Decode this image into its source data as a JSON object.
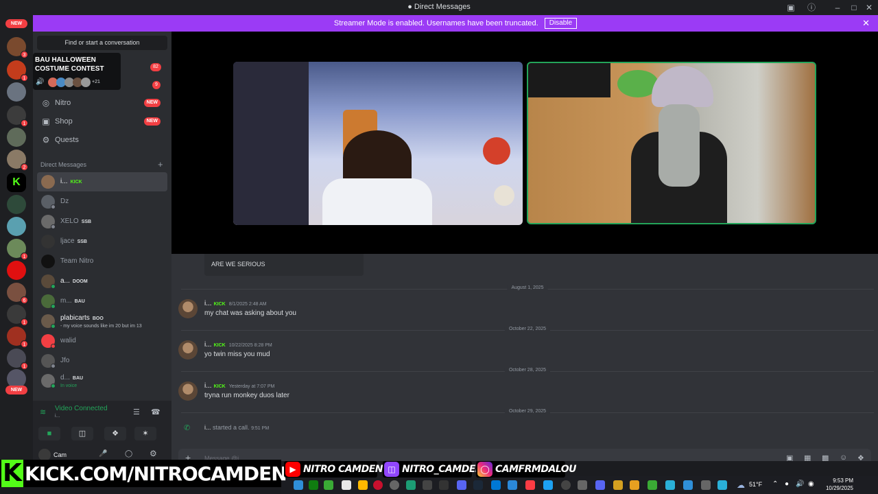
{
  "titlebar": {
    "title": "Direct Messages"
  },
  "banner": {
    "text": "Streamer Mode is enabled. Usernames have been truncated.",
    "button": "Disable"
  },
  "rail": {
    "new_label_top": "NEW",
    "new_label_bottom": "NEW"
  },
  "tooltip": {
    "title": "BAU HALLOWEEN COSTUME CONTEST",
    "count": "+21"
  },
  "sidebar": {
    "search_placeholder": "Find or start a conversation",
    "badges": {
      "friends": "82",
      "requests": "9"
    },
    "nav": [
      {
        "label": "Nitro",
        "tag": "NEW"
      },
      {
        "label": "Shop",
        "tag": "NEW"
      },
      {
        "label": "Quests"
      }
    ],
    "dm_header": "Direct Messages",
    "dms": [
      {
        "name": "i...",
        "tag": "KICK"
      },
      {
        "name": "Dz"
      },
      {
        "name": "XELO",
        "tag": "SSB"
      },
      {
        "name": "ljace",
        "tag": "SSB"
      },
      {
        "name": "Team Nitro"
      },
      {
        "name": "a...",
        "tag": "DOOM"
      },
      {
        "name": "m...",
        "tag": "BAU"
      },
      {
        "name": "plabicarts",
        "tag": "BOO",
        "sub": "- my voice sounds like im 20 but im 13"
      },
      {
        "name": "walid"
      },
      {
        "name": "Jfo"
      },
      {
        "name": "d...",
        "tag": "BAU",
        "sub": "In voice"
      }
    ]
  },
  "voice": {
    "status": "Video Connected",
    "sub": "i..."
  },
  "user": {
    "name": "Cam"
  },
  "chat": {
    "quote": "ARE WE SERIOUS",
    "messages": [
      {
        "date": "August 1, 2025",
        "author": "i...",
        "tag": "KICK",
        "time": "8/1/2025 2:48 AM",
        "text": "my chat was asking about you"
      },
      {
        "date": "October 22, 2025",
        "author": "i...",
        "tag": "KICK",
        "time": "10/22/2025 8:28 PM",
        "text": "yo twin miss you mud"
      },
      {
        "date": "October 28, 2025",
        "author": "i...",
        "tag": "KICK",
        "time": "Yesterday at 7:07 PM",
        "text": "tryna run monkey duos later"
      }
    ],
    "call_date": "October 29, 2025",
    "call": {
      "author": "i...",
      "text": "started a call.",
      "time": "9:51 PM"
    },
    "composer_placeholder": "Message @i..."
  },
  "overlay": {
    "kick": "KICK.COM/NITROCAMDEN",
    "youtube": "NITRO CAMDEN",
    "twitch": "NITRO_CAMDEN",
    "instagram": "CAMFRMDALOU"
  },
  "taskbar": {
    "weather": "51°F",
    "time": "9:53 PM",
    "date": "10/29/2025"
  },
  "colors": {
    "accent": "#9b3bf5",
    "kick": "#53fc18",
    "online": "#23a55a",
    "danger": "#f23f43"
  }
}
